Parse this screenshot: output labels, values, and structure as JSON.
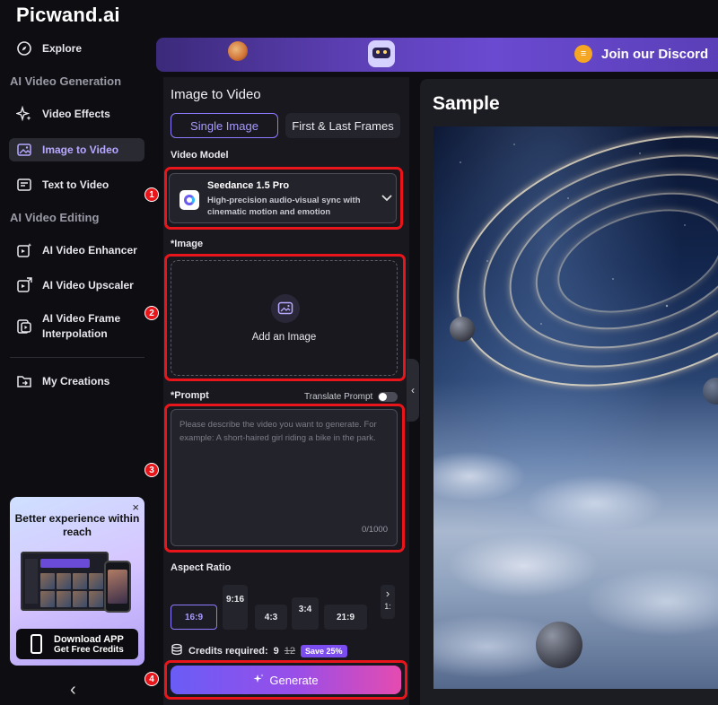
{
  "app": {
    "brand_main": "Picwand",
    "brand_dot": ".",
    "brand_ai": "ai"
  },
  "sidebar": {
    "explore": "Explore",
    "sections": {
      "generation": "AI Video Generation",
      "editing": "AI Video Editing"
    },
    "generation_items": [
      {
        "label": "Video Effects",
        "icon": "sparkle-icon"
      },
      {
        "label": "Image to Video",
        "icon": "image-icon",
        "active": true
      },
      {
        "label": "Text to Video",
        "icon": "text-doc-icon"
      }
    ],
    "editing_items": [
      {
        "label": "AI Video Enhancer",
        "icon": "enhancer-icon"
      },
      {
        "label": "AI Video Upscaler",
        "icon": "upscaler-icon"
      },
      {
        "label": "AI Video Frame Interpolation",
        "icon": "frame-icon"
      }
    ],
    "my_creations": "My Creations",
    "promo": {
      "title": "Better experience within reach",
      "download_label": "Download APP",
      "download_sub": "Get Free Credits",
      "close": "×"
    },
    "collapse": "‹"
  },
  "banner": {
    "discord_text": "Join our Discord"
  },
  "form": {
    "title": "Image to Video",
    "tabs": [
      {
        "label": "Single Image",
        "active": true
      },
      {
        "label": "First & Last Frames",
        "active": false
      }
    ],
    "video_model_label": "Video Model",
    "model": {
      "name": "Seedance 1.5 Pro",
      "description": "High-precision audio-visual sync with cinematic motion and emotion"
    },
    "image_label": "*Image",
    "add_image": "Add an Image",
    "prompt_label": "*Prompt",
    "translate_label": "Translate Prompt",
    "translate_on": false,
    "prompt_placeholder": "Please describe the video you want to generate. For example: A short-haired girl riding a bike in the park.",
    "prompt_value": "",
    "counter": "0/1000",
    "aspect_label": "Aspect Ratio",
    "ratios": [
      {
        "label": "16:9",
        "active": true
      },
      {
        "label": "9:16",
        "active": false
      },
      {
        "label": "4:3",
        "active": false
      },
      {
        "label": "3:4",
        "active": false
      },
      {
        "label": "21:9",
        "active": false
      },
      {
        "label": "1:",
        "active": false
      }
    ],
    "credits_label": "Credits required:",
    "credits_new": "9",
    "credits_old": "12",
    "save_badge": "Save 25%",
    "generate_label": "Generate"
  },
  "annotations": [
    "1",
    "2",
    "3",
    "4"
  ],
  "sample": {
    "title": "Sample"
  },
  "colors": {
    "accent": "#8d7bff",
    "highlight": "#e8151b",
    "generate_start": "#6a5cf6",
    "generate_end": "#e54bb0"
  }
}
